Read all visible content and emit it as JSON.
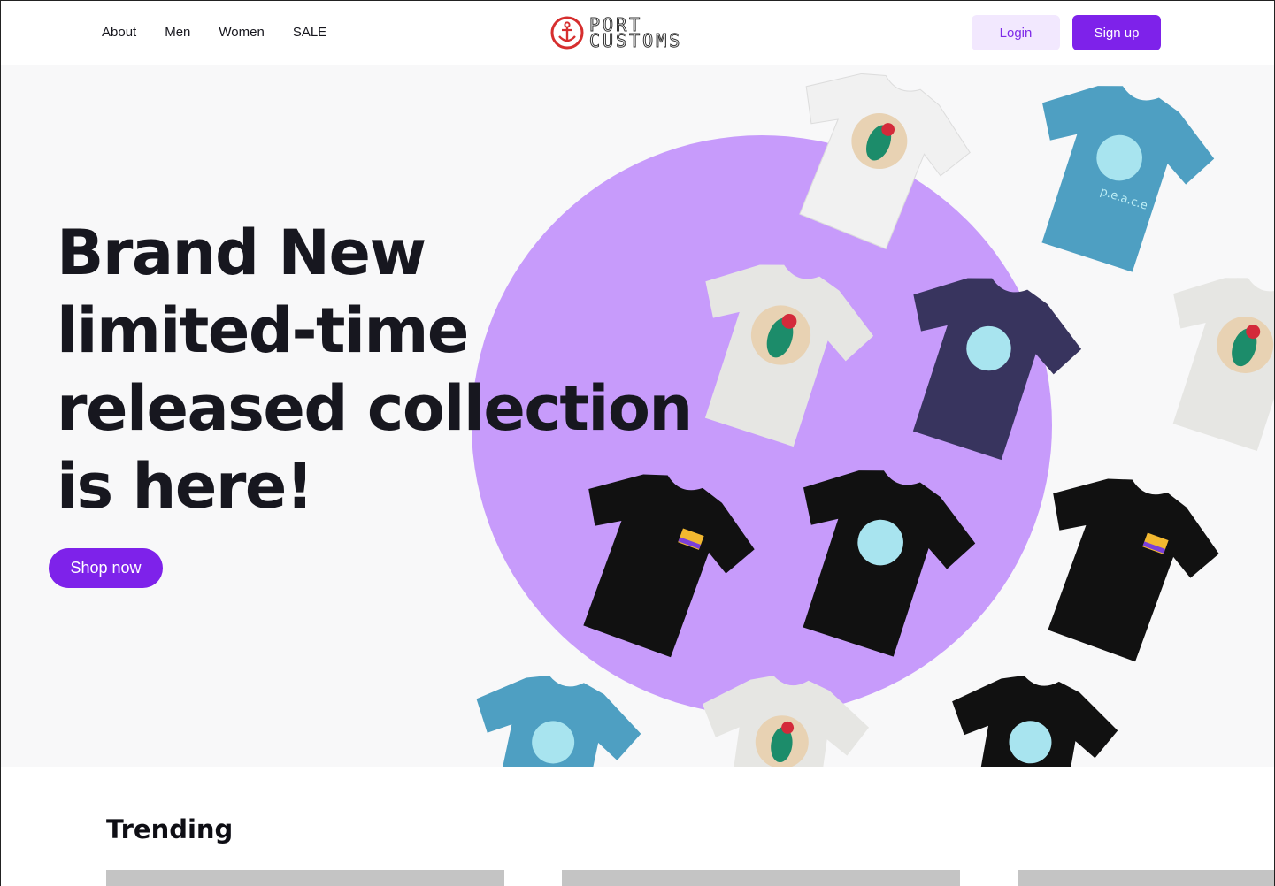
{
  "nav": {
    "items": [
      "About",
      "Men",
      "Women",
      "SALE"
    ]
  },
  "logo": {
    "line1": "PORT",
    "line2": "CUSTOMS"
  },
  "auth": {
    "login_label": "Login",
    "signup_label": "Sign up"
  },
  "hero": {
    "title": "Brand New limited-time released collection is here!",
    "cta_label": "Shop now",
    "shirt_print_text": "p.e.a.c.e"
  },
  "trending": {
    "title": "Trending"
  },
  "colors": {
    "accent": "#7e22ea",
    "accent_light": "#f2e8fe",
    "circle": "#c79bfb",
    "hero_bg": "#f8f8f9",
    "text": "#16161d"
  },
  "icons": {
    "logo_mark": "anchor-icon"
  }
}
